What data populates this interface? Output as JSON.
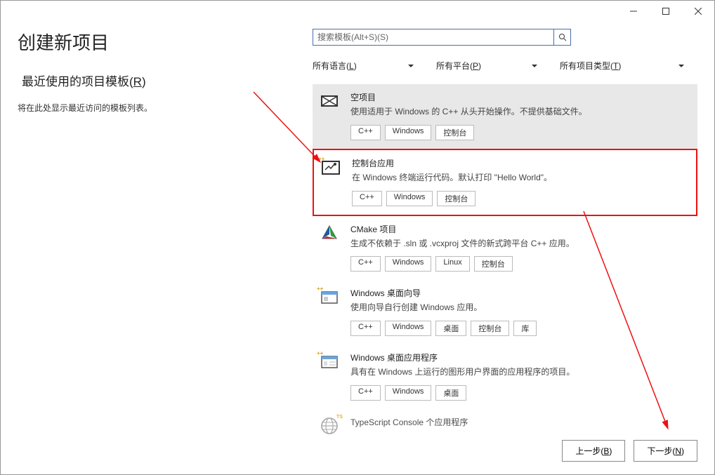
{
  "window": {
    "minimize": "–",
    "maximize": "☐",
    "close": "✕"
  },
  "header": {
    "title": "创建新项目",
    "subtitle_pre": "最近使用的项目模板(",
    "subtitle_u": "R",
    "subtitle_post": ")",
    "recent_text": "将在此处显示最近访问的模板列表。"
  },
  "search": {
    "placeholder": "搜索模板(Alt+S)(S)"
  },
  "filters": {
    "lang_pre": "所有语言(",
    "lang_u": "L",
    "lang_post": ")",
    "plat_pre": "所有平台(",
    "plat_u": "P",
    "plat_post": ")",
    "type_pre": "所有项目类型(",
    "type_u": "T",
    "type_post": ")"
  },
  "templates": [
    {
      "title": "空项目",
      "desc": "使用适用于 Windows 的 C++ 从头开始操作。不提供基础文件。",
      "tags": [
        "C++",
        "Windows",
        "控制台"
      ]
    },
    {
      "title": "控制台应用",
      "desc": "在 Windows 终端运行代码。默认打印 \"Hello World\"。",
      "tags": [
        "C++",
        "Windows",
        "控制台"
      ]
    },
    {
      "title": "CMake 项目",
      "desc": "生成不依赖于 .sln 或 .vcxproj 文件的新式跨平台 C++ 应用。",
      "tags": [
        "C++",
        "Windows",
        "Linux",
        "控制台"
      ]
    },
    {
      "title": "Windows 桌面向导",
      "desc": "使用向导自行创建 Windows 应用。",
      "tags": [
        "C++",
        "Windows",
        "桌面",
        "控制台",
        "库"
      ]
    },
    {
      "title": "Windows 桌面应用程序",
      "desc": "具有在 Windows 上运行的图形用户界面的应用程序的项目。",
      "tags": [
        "C++",
        "Windows",
        "桌面"
      ]
    },
    {
      "title": "TypeScript Console 个应用程序",
      "desc": "",
      "tags": []
    }
  ],
  "footer": {
    "back_pre": "上一步(",
    "back_u": "B",
    "back_post": ")",
    "next_pre": "下一步(",
    "next_u": "N",
    "next_post": ")"
  }
}
